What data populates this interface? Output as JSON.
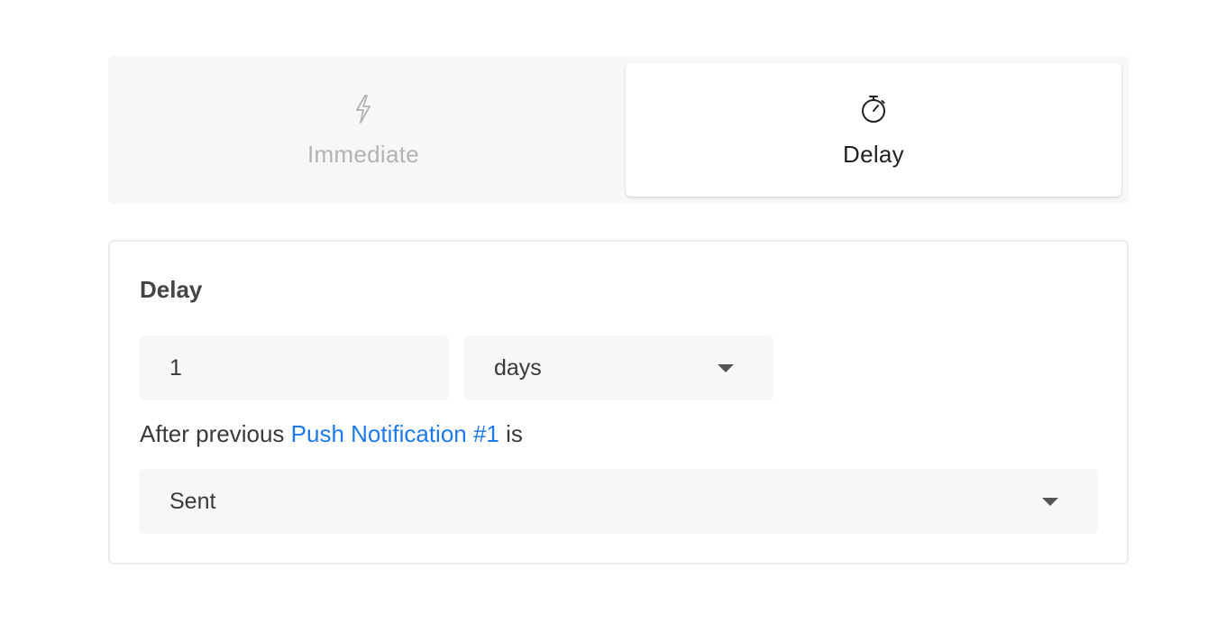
{
  "tabs": [
    {
      "label": "Immediate",
      "icon": "lightning-icon",
      "selected": false
    },
    {
      "label": "Delay",
      "icon": "stopwatch-icon",
      "selected": true
    }
  ],
  "delay": {
    "title": "Delay",
    "amount": "1",
    "unit": "days",
    "sentence_prefix": "After previous",
    "sentence_link": "Push Notification #1",
    "sentence_suffix": "is",
    "status": "Sent"
  },
  "colors": {
    "link": "#1f7ae8",
    "tab_bg": "#f6f7f9",
    "field_bg": "#f6f7f9",
    "inactive_text": "#b3b3b3"
  }
}
